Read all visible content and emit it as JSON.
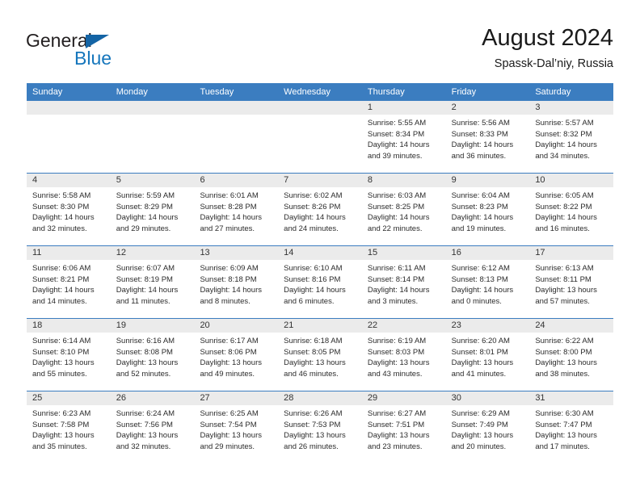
{
  "brand": {
    "name_part1": "General",
    "name_part2": "Blue",
    "color_dark": "#231f20",
    "color_blue": "#1576bc"
  },
  "header": {
    "title": "August 2024",
    "subtitle": "Spassk-Dal’niy, Russia"
  },
  "calendar": {
    "accent_color": "#3b7dc0",
    "day_header_bg": "#ebebeb",
    "weekdays": [
      "Sunday",
      "Monday",
      "Tuesday",
      "Wednesday",
      "Thursday",
      "Friday",
      "Saturday"
    ],
    "weeks": [
      [
        {
          "day": "",
          "lines": []
        },
        {
          "day": "",
          "lines": []
        },
        {
          "day": "",
          "lines": []
        },
        {
          "day": "",
          "lines": []
        },
        {
          "day": "1",
          "lines": [
            "Sunrise: 5:55 AM",
            "Sunset: 8:34 PM",
            "Daylight: 14 hours",
            "and 39 minutes."
          ]
        },
        {
          "day": "2",
          "lines": [
            "Sunrise: 5:56 AM",
            "Sunset: 8:33 PM",
            "Daylight: 14 hours",
            "and 36 minutes."
          ]
        },
        {
          "day": "3",
          "lines": [
            "Sunrise: 5:57 AM",
            "Sunset: 8:32 PM",
            "Daylight: 14 hours",
            "and 34 minutes."
          ]
        }
      ],
      [
        {
          "day": "4",
          "lines": [
            "Sunrise: 5:58 AM",
            "Sunset: 8:30 PM",
            "Daylight: 14 hours",
            "and 32 minutes."
          ]
        },
        {
          "day": "5",
          "lines": [
            "Sunrise: 5:59 AM",
            "Sunset: 8:29 PM",
            "Daylight: 14 hours",
            "and 29 minutes."
          ]
        },
        {
          "day": "6",
          "lines": [
            "Sunrise: 6:01 AM",
            "Sunset: 8:28 PM",
            "Daylight: 14 hours",
            "and 27 minutes."
          ]
        },
        {
          "day": "7",
          "lines": [
            "Sunrise: 6:02 AM",
            "Sunset: 8:26 PM",
            "Daylight: 14 hours",
            "and 24 minutes."
          ]
        },
        {
          "day": "8",
          "lines": [
            "Sunrise: 6:03 AM",
            "Sunset: 8:25 PM",
            "Daylight: 14 hours",
            "and 22 minutes."
          ]
        },
        {
          "day": "9",
          "lines": [
            "Sunrise: 6:04 AM",
            "Sunset: 8:23 PM",
            "Daylight: 14 hours",
            "and 19 minutes."
          ]
        },
        {
          "day": "10",
          "lines": [
            "Sunrise: 6:05 AM",
            "Sunset: 8:22 PM",
            "Daylight: 14 hours",
            "and 16 minutes."
          ]
        }
      ],
      [
        {
          "day": "11",
          "lines": [
            "Sunrise: 6:06 AM",
            "Sunset: 8:21 PM",
            "Daylight: 14 hours",
            "and 14 minutes."
          ]
        },
        {
          "day": "12",
          "lines": [
            "Sunrise: 6:07 AM",
            "Sunset: 8:19 PM",
            "Daylight: 14 hours",
            "and 11 minutes."
          ]
        },
        {
          "day": "13",
          "lines": [
            "Sunrise: 6:09 AM",
            "Sunset: 8:18 PM",
            "Daylight: 14 hours",
            "and 8 minutes."
          ]
        },
        {
          "day": "14",
          "lines": [
            "Sunrise: 6:10 AM",
            "Sunset: 8:16 PM",
            "Daylight: 14 hours",
            "and 6 minutes."
          ]
        },
        {
          "day": "15",
          "lines": [
            "Sunrise: 6:11 AM",
            "Sunset: 8:14 PM",
            "Daylight: 14 hours",
            "and 3 minutes."
          ]
        },
        {
          "day": "16",
          "lines": [
            "Sunrise: 6:12 AM",
            "Sunset: 8:13 PM",
            "Daylight: 14 hours",
            "and 0 minutes."
          ]
        },
        {
          "day": "17",
          "lines": [
            "Sunrise: 6:13 AM",
            "Sunset: 8:11 PM",
            "Daylight: 13 hours",
            "and 57 minutes."
          ]
        }
      ],
      [
        {
          "day": "18",
          "lines": [
            "Sunrise: 6:14 AM",
            "Sunset: 8:10 PM",
            "Daylight: 13 hours",
            "and 55 minutes."
          ]
        },
        {
          "day": "19",
          "lines": [
            "Sunrise: 6:16 AM",
            "Sunset: 8:08 PM",
            "Daylight: 13 hours",
            "and 52 minutes."
          ]
        },
        {
          "day": "20",
          "lines": [
            "Sunrise: 6:17 AM",
            "Sunset: 8:06 PM",
            "Daylight: 13 hours",
            "and 49 minutes."
          ]
        },
        {
          "day": "21",
          "lines": [
            "Sunrise: 6:18 AM",
            "Sunset: 8:05 PM",
            "Daylight: 13 hours",
            "and 46 minutes."
          ]
        },
        {
          "day": "22",
          "lines": [
            "Sunrise: 6:19 AM",
            "Sunset: 8:03 PM",
            "Daylight: 13 hours",
            "and 43 minutes."
          ]
        },
        {
          "day": "23",
          "lines": [
            "Sunrise: 6:20 AM",
            "Sunset: 8:01 PM",
            "Daylight: 13 hours",
            "and 41 minutes."
          ]
        },
        {
          "day": "24",
          "lines": [
            "Sunrise: 6:22 AM",
            "Sunset: 8:00 PM",
            "Daylight: 13 hours",
            "and 38 minutes."
          ]
        }
      ],
      [
        {
          "day": "25",
          "lines": [
            "Sunrise: 6:23 AM",
            "Sunset: 7:58 PM",
            "Daylight: 13 hours",
            "and 35 minutes."
          ]
        },
        {
          "day": "26",
          "lines": [
            "Sunrise: 6:24 AM",
            "Sunset: 7:56 PM",
            "Daylight: 13 hours",
            "and 32 minutes."
          ]
        },
        {
          "day": "27",
          "lines": [
            "Sunrise: 6:25 AM",
            "Sunset: 7:54 PM",
            "Daylight: 13 hours",
            "and 29 minutes."
          ]
        },
        {
          "day": "28",
          "lines": [
            "Sunrise: 6:26 AM",
            "Sunset: 7:53 PM",
            "Daylight: 13 hours",
            "and 26 minutes."
          ]
        },
        {
          "day": "29",
          "lines": [
            "Sunrise: 6:27 AM",
            "Sunset: 7:51 PM",
            "Daylight: 13 hours",
            "and 23 minutes."
          ]
        },
        {
          "day": "30",
          "lines": [
            "Sunrise: 6:29 AM",
            "Sunset: 7:49 PM",
            "Daylight: 13 hours",
            "and 20 minutes."
          ]
        },
        {
          "day": "31",
          "lines": [
            "Sunrise: 6:30 AM",
            "Sunset: 7:47 PM",
            "Daylight: 13 hours",
            "and 17 minutes."
          ]
        }
      ]
    ]
  }
}
